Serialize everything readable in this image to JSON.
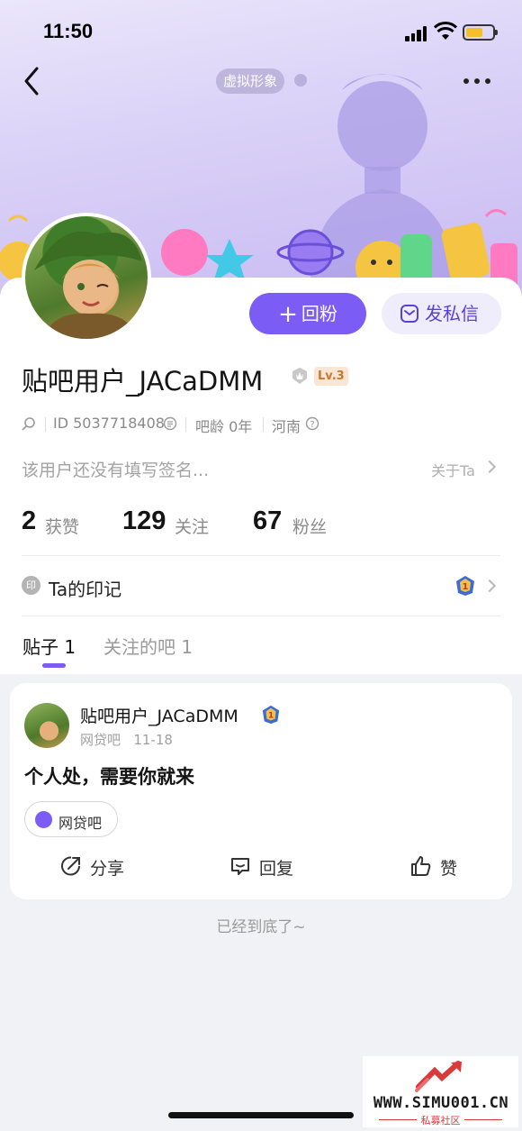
{
  "status_bar": {
    "time": "11:50"
  },
  "header": {
    "avatar_tag": "虚拟形象"
  },
  "actions": {
    "follow_back": "回粉",
    "follow_plus": "+",
    "message": "发私信"
  },
  "user": {
    "name": "贴吧用户_JACaDMM",
    "level": "Lv.3",
    "id_text": "ID 5037718408",
    "age_text": "吧龄 0年",
    "location": "河南",
    "signature": "该用户还没有填写签名...",
    "about_link": "关于Ta"
  },
  "stats": [
    {
      "value": "2",
      "label": "获赞"
    },
    {
      "value": "129",
      "label": "关注"
    },
    {
      "value": "67",
      "label": "粉丝"
    }
  ],
  "seal": {
    "icon_text": "印",
    "label": "Ta的印记"
  },
  "tabs": [
    {
      "label": "贴子 1",
      "active": true
    },
    {
      "label": "关注的吧 1",
      "active": false
    }
  ],
  "post": {
    "author": "贴吧用户_JACaDMM",
    "forum": "网贷吧",
    "date": "11-18",
    "text": "个人处，需要你就来",
    "forum_chip": "网贷吧",
    "share": "分享",
    "reply": "回复",
    "like": "赞"
  },
  "end_text": "已经到底了~",
  "watermark": {
    "url": "WWW.SIMU001.CN",
    "sub": "私募社区"
  },
  "colors": {
    "accent": "#7b5cf5",
    "banner": "#d9d0f7"
  }
}
